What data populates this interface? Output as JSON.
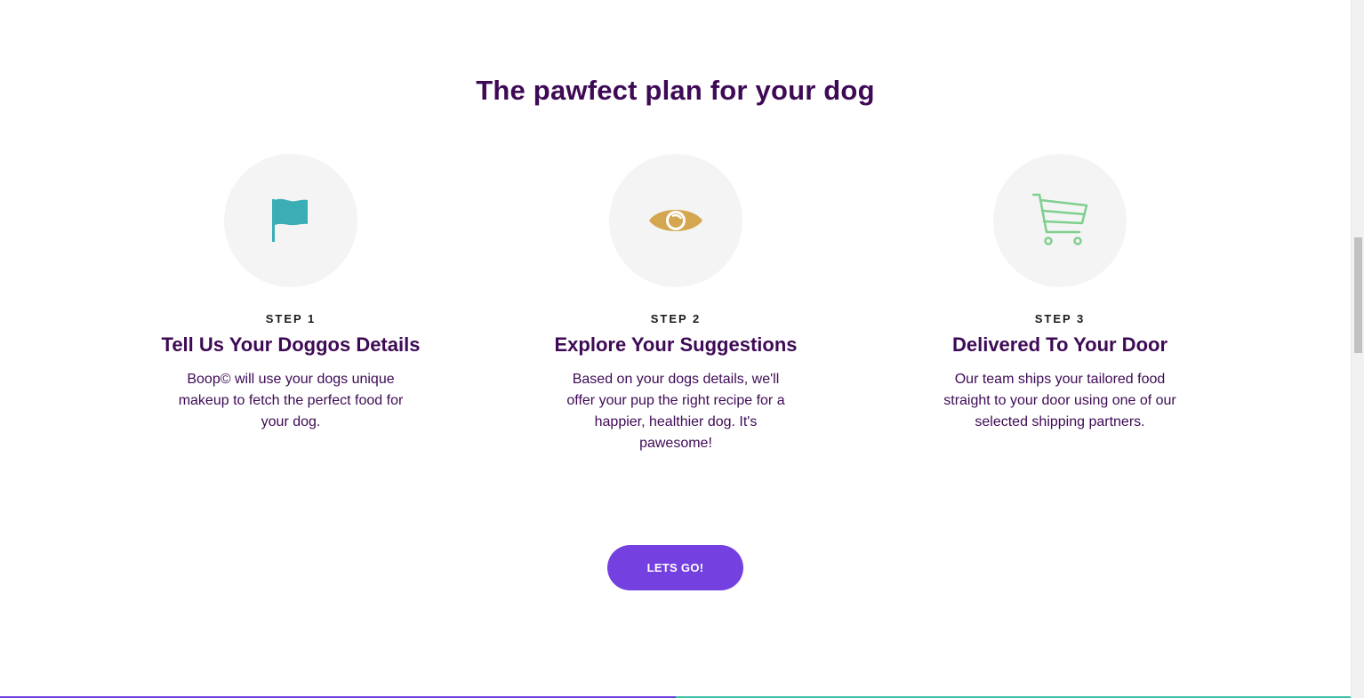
{
  "section": {
    "title": "The pawfect plan for your dog"
  },
  "steps": [
    {
      "label": "STEP 1",
      "heading": "Tell Us Your Doggos Details",
      "description": "Boop© will use your dogs unique makeup to fetch the perfect food for your dog.",
      "icon": "flag-icon",
      "icon_color": "#3aaeb4"
    },
    {
      "label": "STEP 2",
      "heading": "Explore Your Suggestions",
      "description": "Based on your dogs details, we'll offer your pup the right recipe for a happier, healthier dog. It's pawesome!",
      "icon": "eye-icon",
      "icon_color": "#d4a64f"
    },
    {
      "label": "STEP 3",
      "heading": "Delivered To Your Door",
      "description": "Our team ships your tailored food straight to your door using one of our selected shipping partners.",
      "icon": "shopping-cart-icon",
      "icon_color": "#7fcf8f"
    }
  ],
  "cta": {
    "label": "LETS GO!",
    "color": "#7440e0"
  },
  "colors": {
    "heading": "#3e0a55",
    "circle_bg": "#f4f4f4"
  }
}
